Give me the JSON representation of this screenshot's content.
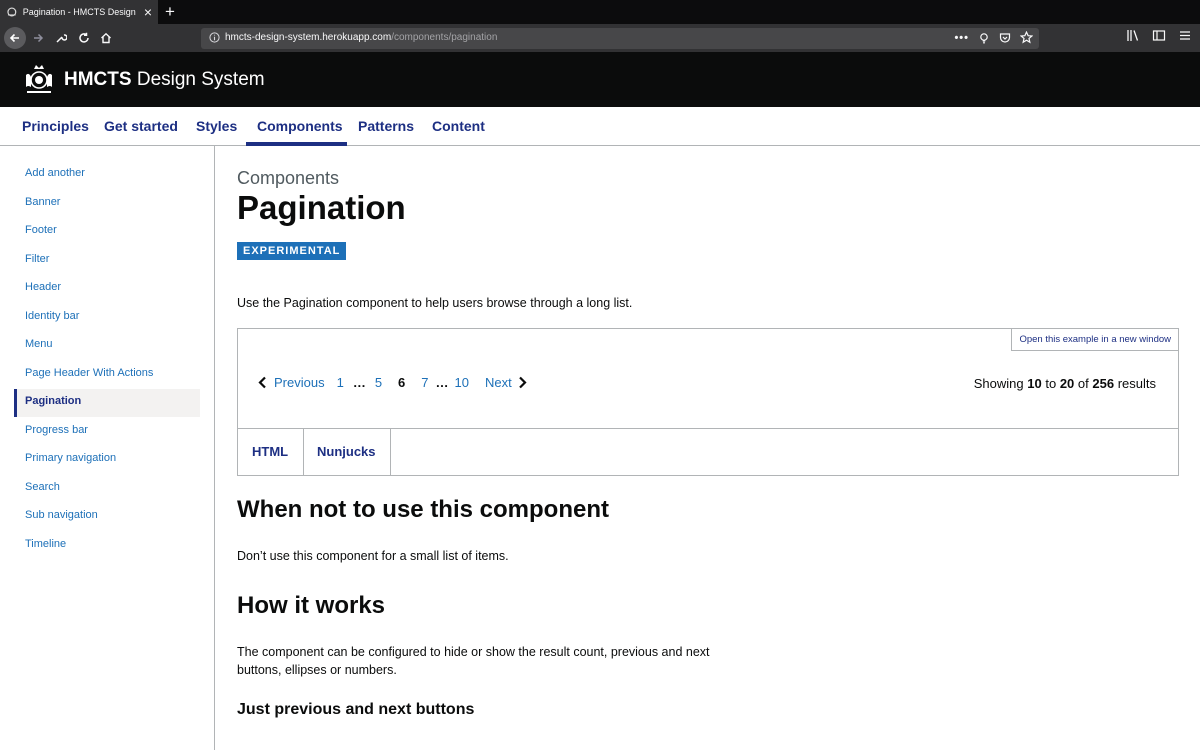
{
  "browser": {
    "tab_title": "Pagination - HMCTS Design Sy…",
    "url_host": "hmcts-design-system.herokuapp.com",
    "url_path": "/components/pagination"
  },
  "header": {
    "title_bold": "HMCTS",
    "title_rest": " Design System"
  },
  "topnav": [
    "Principles",
    "Get started",
    "Styles",
    "Components",
    "Patterns",
    "Content"
  ],
  "sidebar": {
    "items": [
      "Add another",
      "Banner",
      "Footer",
      "Filter",
      "Header",
      "Identity bar",
      "Menu",
      "Page Header With Actions",
      "Pagination",
      "Progress bar",
      "Primary navigation",
      "Search",
      "Sub navigation",
      "Timeline"
    ],
    "active": "Pagination"
  },
  "main": {
    "caption": "Components",
    "title": "Pagination",
    "tag": "EXPERIMENTAL",
    "lead": "Use the Pagination component to help users browse through a long list.",
    "open_example": "Open this example in a new window",
    "pagination": {
      "previous": "Previous",
      "next": "Next",
      "ellipsis": "…",
      "pages": {
        "p1": "1",
        "p5": "5",
        "p6": "6",
        "p7": "7",
        "p10": "10"
      }
    },
    "results": {
      "prefix": "Showing",
      "from": "10",
      "to_word": "to",
      "to": "20",
      "of_word": "of",
      "total": "256",
      "suffix": "results"
    },
    "code_tabs": [
      "HTML",
      "Nunjucks"
    ],
    "when_not_heading": "When not to use this component",
    "when_not_text": "Don’t use this component for a small list of items.",
    "how_heading": "How it works",
    "how_text_line1": "The component can be configured to hide or show the result count, previous and next",
    "how_text_line2": "buttons, ellipses or numbers.",
    "just_heading": "Just previous and next buttons"
  }
}
